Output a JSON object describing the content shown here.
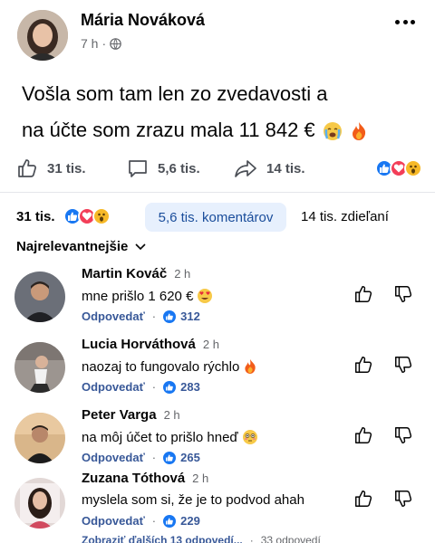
{
  "post": {
    "author": "Mária Nováková",
    "time": "7 h",
    "text_line1": "Vošla som tam len zo zvedavosti a",
    "text_line2": "na účte som zrazu mala 11 842 €",
    "text_emojis": [
      "crying-face",
      "fire"
    ]
  },
  "actions": {
    "like_count": "31 tis.",
    "comment_count": "5,6 tis.",
    "share_count": "14 tis."
  },
  "stats": {
    "likes": "31 tis.",
    "comments": "5,6 tis. komentárov",
    "shares": "14 tis. zdieľaní"
  },
  "sort": {
    "label": "Najrelevantnejšie"
  },
  "comments": [
    {
      "name": "Martin Kováč",
      "time": "2 h",
      "text": "mne prišlo 1 620 €",
      "emoji": "heart-eyes",
      "reply": "Odpovedať",
      "likes": "312"
    },
    {
      "name": "Lucia Horváthová",
      "time": "2 h",
      "text": "naozaj to fungovalo rýchlo",
      "emoji": "fire",
      "reply": "Odpovedať",
      "likes": "283"
    },
    {
      "name": "Peter Varga",
      "time": "2 h",
      "text": "na môj účet to prišlo hneď",
      "emoji": "flushed",
      "reply": "Odpovedať",
      "likes": "265"
    },
    {
      "name": "Zuzana Tóthová",
      "time": "2 h",
      "text": "myslela som si, že je to podvod ahah",
      "emoji": "",
      "reply": "Odpovedať",
      "likes": "229"
    }
  ],
  "more_replies": {
    "label": "Zobraziť ďalších 13 odpovedí...",
    "count": "33 odpovedí"
  },
  "colors": {
    "like_blue": "#1877f2",
    "love_red": "#f33e58",
    "wow_yellow": "#f7b928",
    "link_blue": "#385898",
    "comments_pill": "#e7f0fd"
  }
}
